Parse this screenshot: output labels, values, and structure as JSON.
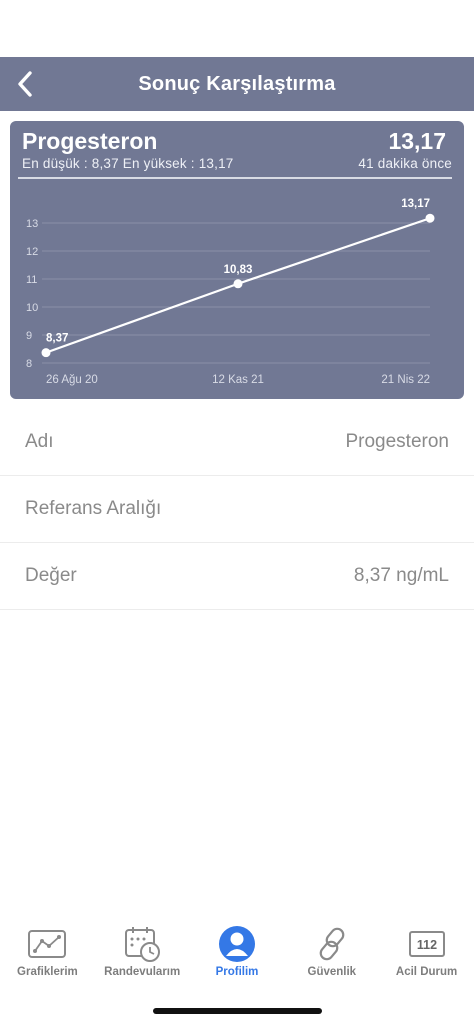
{
  "navbar": {
    "title": "Sonuç Karşılaştırma",
    "back_icon": "chevron-left-icon"
  },
  "card": {
    "test_name": "Progesteron",
    "latest_value": "13,17",
    "min_max": "En düşük : 8,37 En yüksek : 13,17",
    "time_ago": "41 dakika önce"
  },
  "chart_data": {
    "type": "line",
    "x": [
      "26 Ağu 20",
      "12 Kas 21",
      "21 Nis 22"
    ],
    "series": [
      {
        "values": [
          8.37,
          10.83,
          13.17
        ]
      }
    ],
    "data_labels": [
      "8,37",
      "10,83",
      "13,17"
    ],
    "yticks": [
      "8",
      "9",
      "10",
      "11",
      "12",
      "13"
    ],
    "ylim": [
      8,
      13.5
    ],
    "grid": true,
    "colors": {
      "background": "#717894",
      "line": "#ffffff",
      "grid": "#8a90a8",
      "tick": "#d8dbe6"
    }
  },
  "details": [
    {
      "label": "Adı",
      "value": "Progesteron"
    },
    {
      "label": "Referans Aralığı",
      "value": ""
    },
    {
      "label": "Değer",
      "value": "8,37 ng/mL"
    }
  ],
  "tabs": [
    {
      "label": "Grafiklerim",
      "icon": "line-chart-icon",
      "active": false
    },
    {
      "label": "Randevularım",
      "icon": "calendar-clock-icon",
      "active": false
    },
    {
      "label": "Profilim",
      "icon": "user-icon",
      "active": true
    },
    {
      "label": "Güvenlik",
      "icon": "link-icon",
      "active": false
    },
    {
      "label": "Acil Durum",
      "icon": "emergency-112-icon",
      "active": false
    },
    {
      "badge": "112"
    }
  ],
  "colors": {
    "accent": "#3478e6",
    "header": "#717894"
  }
}
